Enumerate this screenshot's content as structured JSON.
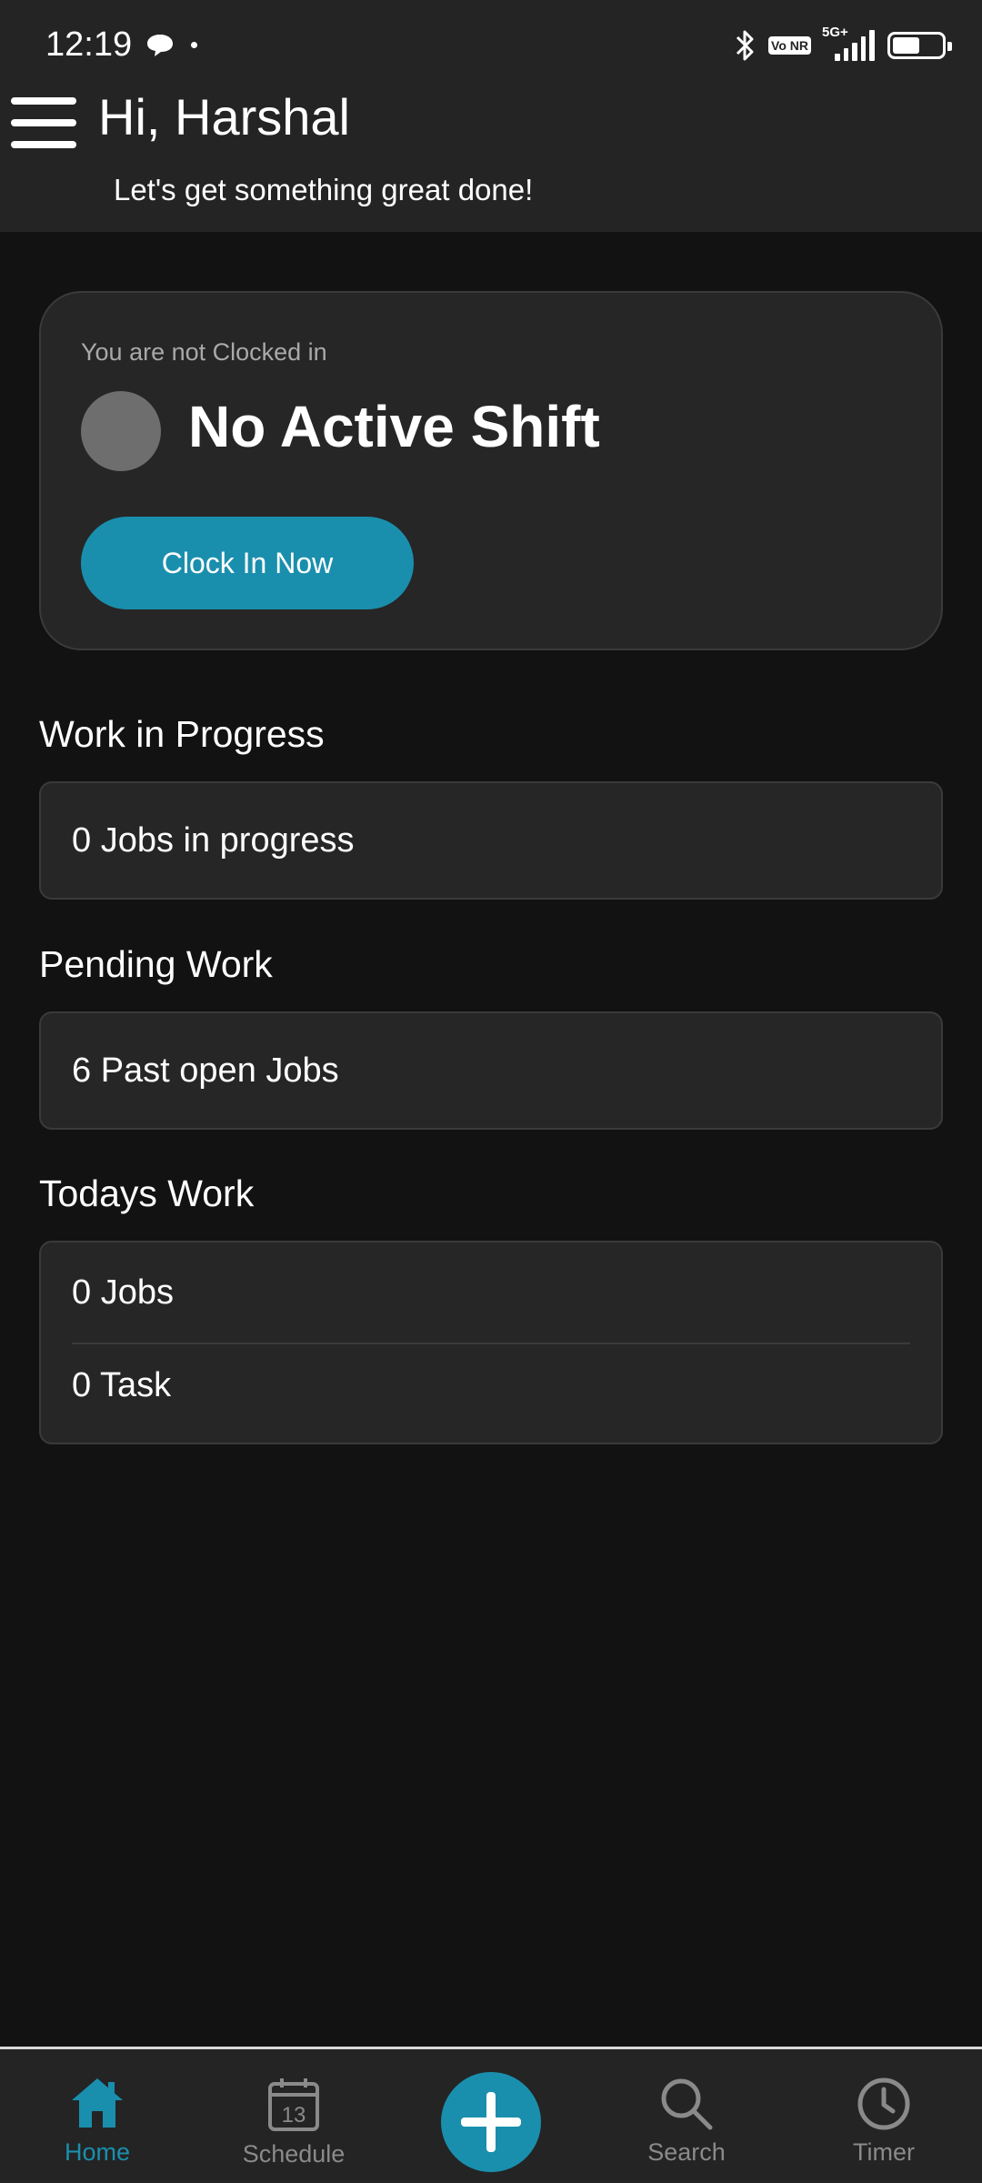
{
  "status_bar": {
    "time": "12:19",
    "volte_label": "Vo NR",
    "network_label": "5G+",
    "battery_level": 0.55,
    "icons": [
      "chat-icon",
      "bluetooth-icon",
      "signal-icon",
      "battery-icon"
    ]
  },
  "header": {
    "greeting": "Hi, Harshal",
    "subtitle": "Let's get something great done!",
    "menu_icon": "hamburger-menu-icon"
  },
  "shift": {
    "status_text": "You are not Clocked in",
    "title": "No Active Shift",
    "button_label": "Clock In Now"
  },
  "sections": {
    "work_in_progress": {
      "title": "Work in Progress",
      "rows": [
        "0 Jobs in progress"
      ]
    },
    "pending_work": {
      "title": "Pending Work",
      "rows": [
        "6 Past open Jobs"
      ]
    },
    "todays_work": {
      "title": "Todays Work",
      "rows": [
        "0 Jobs",
        "0 Task"
      ]
    }
  },
  "bottom_nav": {
    "items": [
      {
        "label": "Home",
        "icon": "home-icon",
        "active": true
      },
      {
        "label": "Schedule",
        "icon": "calendar-icon",
        "calendar_day": "13",
        "active": false
      },
      {
        "label": "",
        "icon": "plus-icon",
        "active": false
      },
      {
        "label": "Search",
        "icon": "search-icon",
        "active": false
      },
      {
        "label": "Timer",
        "icon": "clock-icon",
        "active": false
      }
    ]
  },
  "colors": {
    "accent": "#1a8fad",
    "background": "#121212",
    "surface": "#262626",
    "header": "#242424",
    "muted_text": "#a9a9a9"
  }
}
